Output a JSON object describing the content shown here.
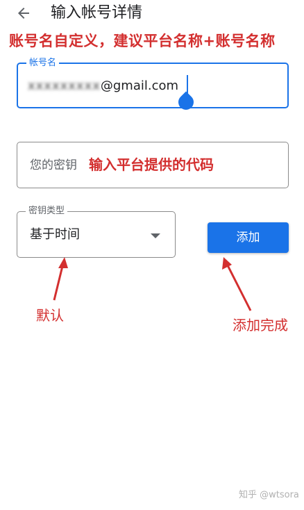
{
  "header": {
    "back_icon": "arrow-back-icon",
    "title": "输入帐号详情"
  },
  "annotations": {
    "top": "账号名自定义，建议平台名称+账号名称",
    "key_hint": "输入平台提供的代码",
    "default_hint": "默认",
    "done_hint": "添加完成",
    "color": "#d32f2f"
  },
  "form": {
    "account": {
      "label": "帐号名",
      "value_hidden": "xxxxxxxxx",
      "value_visible": "@gmail.com"
    },
    "key": {
      "placeholder": "您的密钥"
    },
    "key_type": {
      "label": "密钥类型",
      "selected": "基于时间"
    },
    "add_button": "添加"
  },
  "watermark": "知乎 @wtsora",
  "colors": {
    "accent": "#1a73e8",
    "annotation": "#d32f2f"
  }
}
